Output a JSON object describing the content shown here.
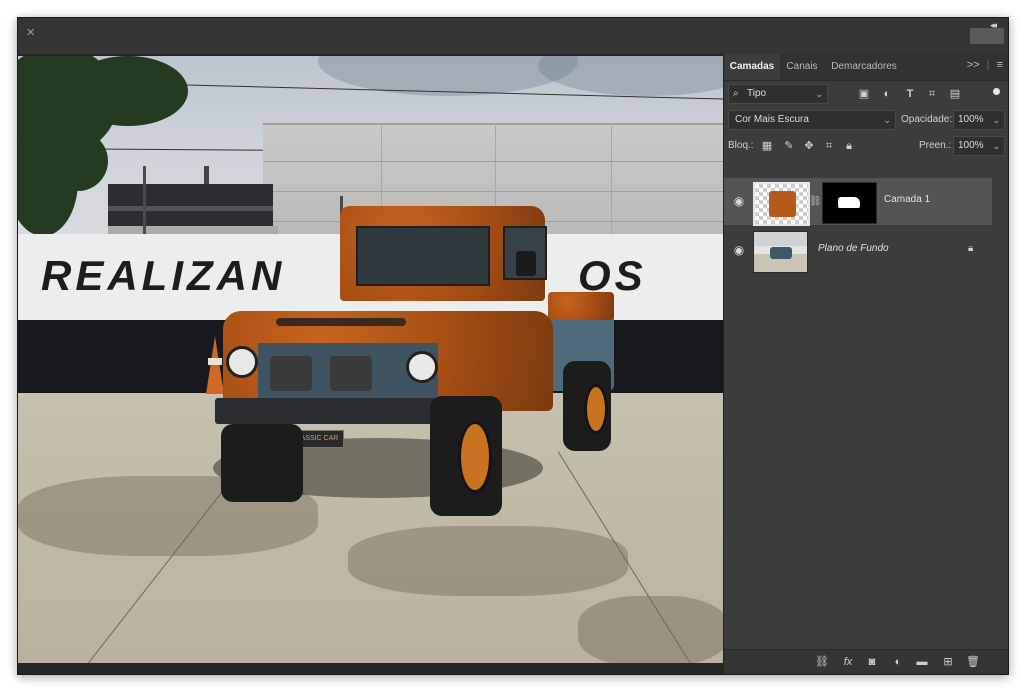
{
  "layers_panel": {
    "tabs": [
      "Camadas",
      "Canais",
      "Demarcadores"
    ],
    "filter_kind": "Tipo",
    "blend_mode": "Cor Mais Escura",
    "opacity_label": "Opacidade:",
    "opacity_value": "100%",
    "lock_label": "Bloq.:",
    "fill_label": "Preen.:",
    "fill_value": "100%",
    "layers": [
      {
        "name": "Camada 1",
        "visible": true,
        "selected": true,
        "has_mask": true
      },
      {
        "name": "Plano de Fundo",
        "visible": true,
        "selected": false,
        "locked": true
      }
    ]
  },
  "canvas": {
    "wall_text_left": "REALIZAN",
    "wall_text_right": "OS",
    "plate_text": "CLASSIC CAR"
  },
  "colors": {
    "panel_bg": "#3c3c3c",
    "selected_layer": "#545454",
    "rust": "#b5561a"
  },
  "icons": {
    "tab_menu": "hamburger-icon",
    "expand": "double-chevron-icon"
  }
}
